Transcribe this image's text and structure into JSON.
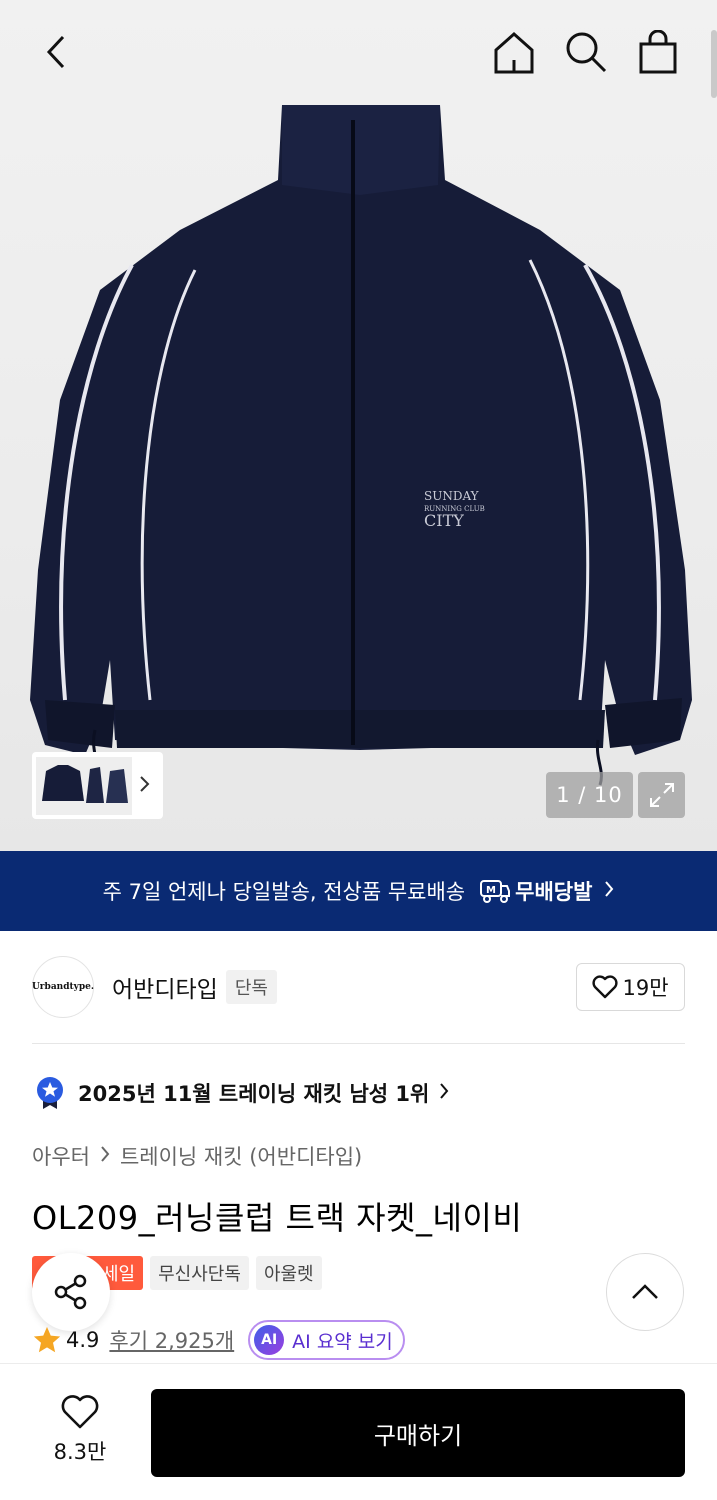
{
  "gallery": {
    "counter": "1 / 10"
  },
  "banner": {
    "text": "주 7일 언제나 당일발송, 전상품 무료배송",
    "brand": "무배당발"
  },
  "store": {
    "logo_text": "Urbandtype.",
    "name": "어반디타입",
    "exclusive_tag": "단독",
    "likes": "19만"
  },
  "ranking": {
    "text": "2025년 11월 트레이닝 재킷 남성 1위"
  },
  "breadcrumb": {
    "category": "아우터",
    "subcategory": "트레이닝 재킷 (어반디타입)"
  },
  "product": {
    "title": "OL209_러닝클럽 트랙 자켓_네이비",
    "tags": [
      "세일",
      "무신사단독",
      "아울렛"
    ],
    "rating": "4.9",
    "reviews": "후기 2,925개",
    "ai_badge": "AI",
    "ai_summary": "AI 요약 보기",
    "print_text_1": "SUNDAY",
    "print_text_2": "RUNNING CLUB",
    "print_text_3": "CITY"
  },
  "bottom": {
    "wish_count": "8.3만",
    "buy_label": "구매하기"
  },
  "colors": {
    "banner_bg": "#0a2a73",
    "jacket": "#161c38",
    "sale_tag": "#ff5a3c",
    "ai_accent": "#5a2fd0"
  }
}
